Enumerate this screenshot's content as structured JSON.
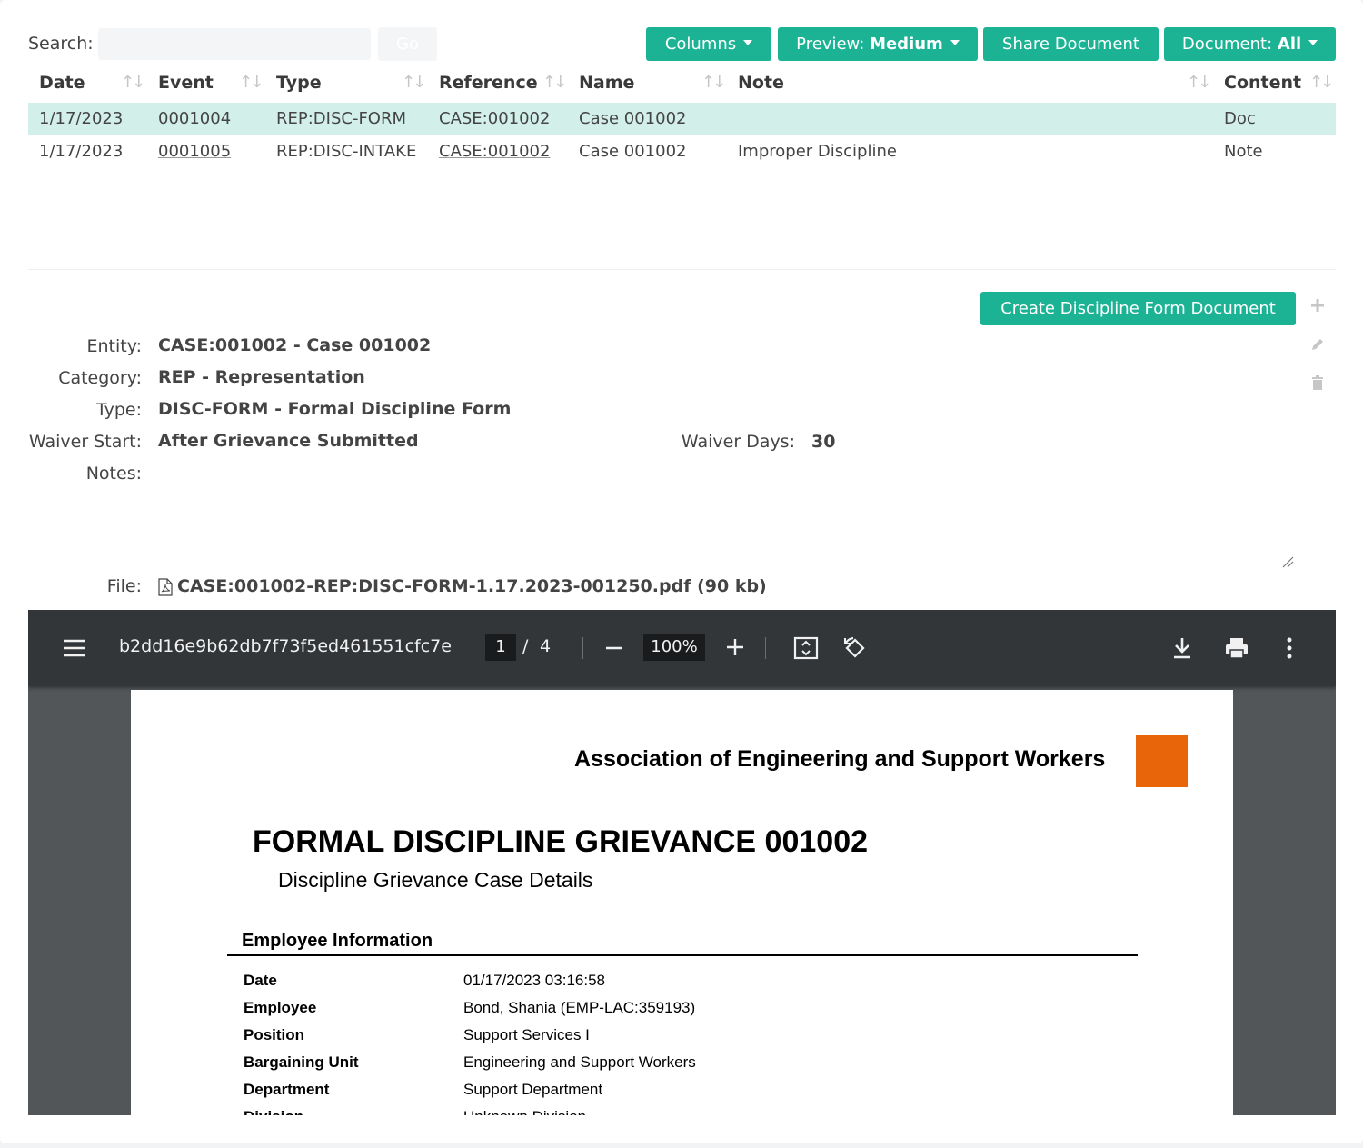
{
  "search": {
    "label": "Search:",
    "placeholder": "",
    "value": "",
    "go_label": "Go"
  },
  "toolbar": {
    "columns_label": "Columns",
    "preview_prefix": "Preview:",
    "preview_value": "Medium",
    "share_label": "Share Document",
    "document_prefix": "Document:",
    "document_value": "All"
  },
  "table": {
    "headers": [
      "Date",
      "Event",
      "Type",
      "Reference",
      "Name",
      "Note",
      "Content"
    ],
    "rows": [
      {
        "date": "1/17/2023",
        "event": "0001004",
        "type": "REP:DISC-FORM",
        "reference": "CASE:001002",
        "name": "Case 001002",
        "note": "",
        "content": "Doc",
        "selected": true
      },
      {
        "date": "1/17/2023",
        "event": "0001005",
        "type": "REP:DISC-INTAKE",
        "reference": "CASE:001002",
        "name": "Case 001002",
        "note": "Improper Discipline",
        "content": "Note",
        "selected": false
      }
    ]
  },
  "detail": {
    "create_button": "Create Discipline Form Document",
    "entity_label": "Entity:",
    "entity_value": "CASE:001002 - Case 001002",
    "category_label": "Category:",
    "category_value": "REP - Representation",
    "type_label": "Type:",
    "type_value": "DISC-FORM - Formal Discipline Form",
    "waiver_start_label": "Waiver Start:",
    "waiver_start_value": "After Grievance Submitted",
    "waiver_days_label": "Waiver Days:",
    "waiver_days_value": "30",
    "notes_label": "Notes:",
    "notes_value": "",
    "file_label": "File:",
    "file_value": "CASE:001002-REP:DISC-FORM-1.17.2023-001250.pdf (90 kb)"
  },
  "viewer": {
    "doc_id": "b2dd16e9b62db7f73f5ed461551cfc7e",
    "page_current": "1",
    "page_sep": "/",
    "page_total": "4",
    "zoom": "100%",
    "icons": [
      "menu-icon",
      "zoom-out-icon",
      "zoom-in-icon",
      "fit-page-icon",
      "rotate-icon",
      "download-icon",
      "print-icon",
      "more-icon"
    ]
  },
  "pdf_page": {
    "organization": "Association of Engineering and Support Workers",
    "logo_color": "#e8650a",
    "title": "FORMAL DISCIPLINE GRIEVANCE 001002",
    "subtitle": "Discipline Grievance Case Details",
    "section_title": "Employee Information",
    "fields": [
      {
        "label": "Date",
        "value": "01/17/2023 03:16:58"
      },
      {
        "label": "Employee",
        "value": "Bond, Shania (EMP-LAC:359193)"
      },
      {
        "label": "Position",
        "value": "Support Services I"
      },
      {
        "label": "Bargaining Unit",
        "value": "Engineering and Support Workers"
      },
      {
        "label": "Department",
        "value": "Support Department"
      },
      {
        "label": "Division",
        "value": "Unknown Division"
      }
    ]
  },
  "colors": {
    "accent": "#1bb394",
    "selected_row": "#d2f0e9",
    "viewer_toolbar": "#323639",
    "viewer_bg": "#525659"
  }
}
